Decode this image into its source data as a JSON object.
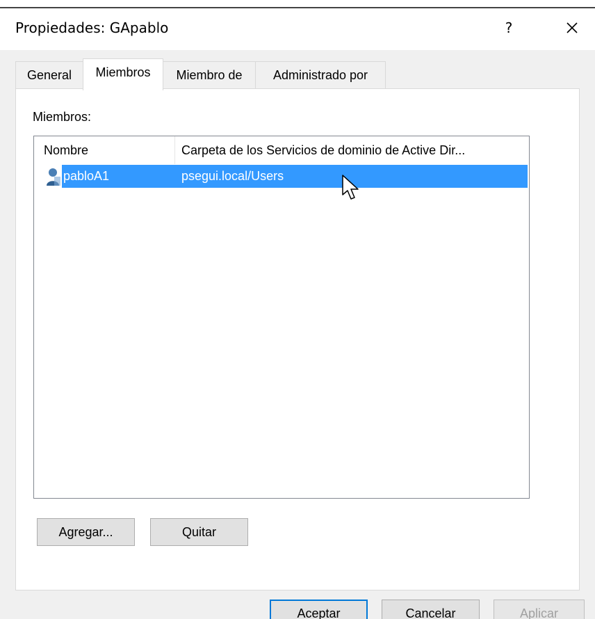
{
  "window": {
    "title": "Propiedades: GApablo",
    "help_label": "?"
  },
  "tabs": [
    {
      "label": "General"
    },
    {
      "label": "Miembros"
    },
    {
      "label": "Miembro de"
    },
    {
      "label": "Administrado por"
    }
  ],
  "members": {
    "label": "Miembros:",
    "columns": [
      "Nombre",
      "Carpeta de los Servicios de dominio de Active Dir..."
    ],
    "rows": [
      {
        "name": "pabloA1",
        "folder": "psegui.local/Users",
        "icon": "user-icon"
      }
    ]
  },
  "buttons": {
    "add": "Agregar...",
    "remove": "Quitar",
    "ok": "Aceptar",
    "cancel": "Cancelar",
    "apply": "Aplicar"
  },
  "colors": {
    "selection": "#3399ff",
    "primary_border": "#0078d7"
  }
}
